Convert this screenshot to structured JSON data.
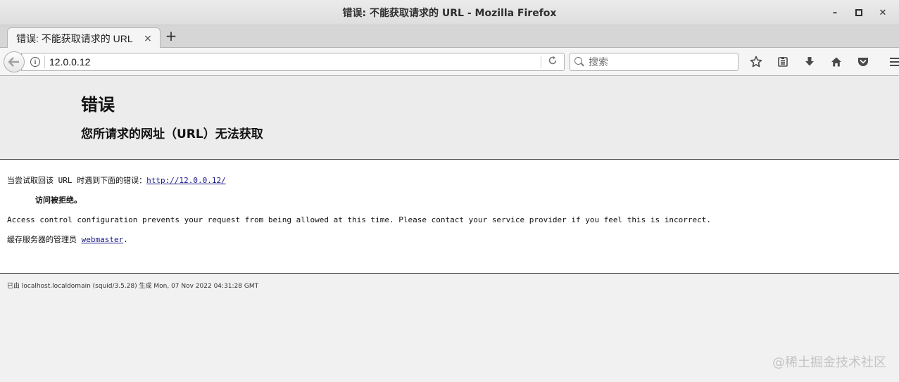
{
  "window": {
    "title": "错误: 不能获取请求的  URL - Mozilla Firefox",
    "controls": {
      "minimize": "–",
      "maximize": "□",
      "close": "✕"
    }
  },
  "tabs": [
    {
      "label": "错误: 不能获取请求的 URL",
      "close": "×"
    }
  ],
  "new_tab": "+",
  "navbar": {
    "url": "12.0.0.12",
    "search_placeholder": "搜索",
    "icons": [
      "back-arrow-icon",
      "info-icon",
      "reload-icon",
      "search-icon",
      "bookmark-star-icon",
      "reading-list-icon",
      "download-icon",
      "home-icon",
      "pocket-icon",
      "menu-icon"
    ]
  },
  "page": {
    "title": "错误",
    "subtitle": "您所请求的网址（URL）无法获取",
    "retrieve_prefix": "当尝试取回该 URL 时遇到下面的错误：",
    "retrieve_url": "http://12.0.0.12/",
    "denied": "访问被拒绝。",
    "message": "Access control configuration prevents your request from being allowed at this time. Please contact your service provider if you feel this is incorrect.",
    "admin_prefix": "缓存服务器的管理员",
    "admin_link": "webmaster",
    "admin_suffix": ".",
    "footer": "已由 localhost.localdomain (squid/3.5.28) 生成 Mon, 07 Nov 2022 04:31:28 GMT"
  },
  "watermark": "@稀土掘金技术社区"
}
